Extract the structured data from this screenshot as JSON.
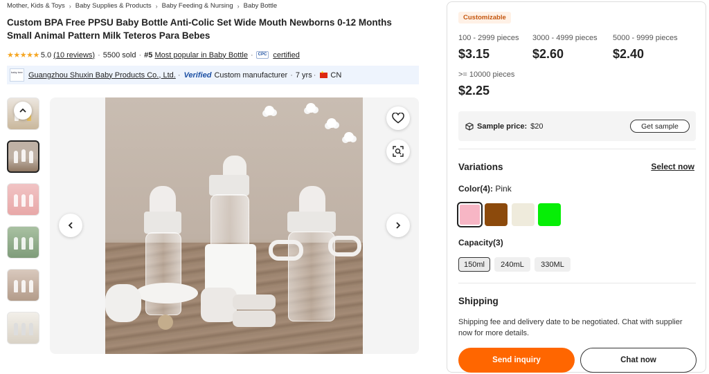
{
  "breadcrumb": [
    "Mother, Kids & Toys",
    "Baby Supplies & Products",
    "Baby Feeding & Nursing",
    "Baby Bottle"
  ],
  "product": {
    "title": "Custom BPA Free PPSU Baby Bottle Anti-Colic Set Wide Mouth Newborns 0-12 Months Small Animal Pattern Milk Teteros Para Bebes",
    "rating": "5.0",
    "stars": "★★★★★",
    "reviews": "(10 reviews)",
    "sold": "5500 sold",
    "rank": "#5",
    "rank_label": "Most popular in Baby Bottle",
    "cpc": "CPC",
    "certified": "certified"
  },
  "supplier": {
    "logo_text": "baby tree",
    "name": "Guangzhou Shuxin Baby Products Co., Ltd.",
    "verified": "Verified",
    "type": "Custom manufacturer",
    "years": "7 yrs",
    "country": "CN"
  },
  "pricing": {
    "badge": "Customizable",
    "tiers": [
      {
        "range": "100 - 2999 pieces",
        "price": "$3.15"
      },
      {
        "range": "3000 - 4999 pieces",
        "price": "$2.60"
      },
      {
        "range": "5000 - 9999 pieces",
        "price": "$2.40"
      },
      {
        "range": ">= 10000 pieces",
        "price": "$2.25"
      }
    ]
  },
  "sample": {
    "label": "Sample price:",
    "price": "$20",
    "button": "Get sample"
  },
  "variations": {
    "title": "Variations",
    "select_now": "Select now",
    "color_label": "Color(4):",
    "color_selected": "Pink",
    "colors": [
      {
        "name": "pink",
        "hex": "#f7b6c5"
      },
      {
        "name": "brown",
        "hex": "#8c4a0c"
      },
      {
        "name": "cream",
        "hex": "#efebdc"
      },
      {
        "name": "green",
        "hex": "#06ee06"
      }
    ],
    "capacity_label": "Capacity(3)",
    "capacities": [
      "150ml",
      "240mL",
      "330ML"
    ]
  },
  "shipping": {
    "title": "Shipping",
    "text": "Shipping fee and delivery date to be negotiated. Chat with supplier now for more details."
  },
  "actions": {
    "inquiry": "Send inquiry",
    "chat": "Chat now"
  },
  "colors": {
    "accent": "#ff6600",
    "badge_text": "#c4560e",
    "badge_bg": "#fff1e6",
    "supplier_bar": "#eef4fd"
  }
}
